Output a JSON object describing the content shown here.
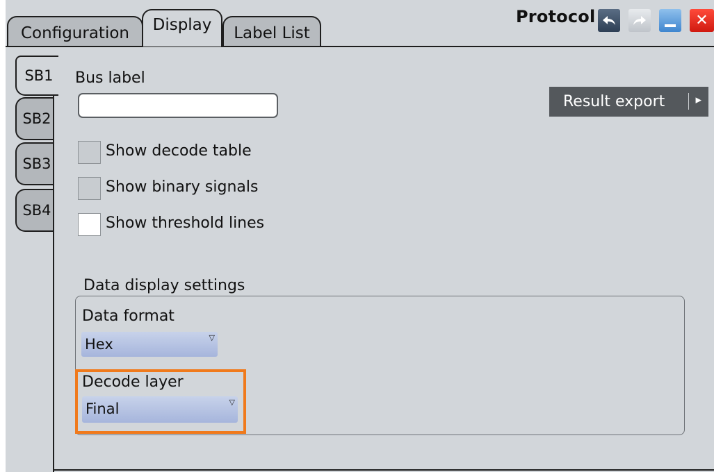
{
  "tabs": {
    "configuration": "Configuration",
    "display": "Display",
    "label_list": "Label List"
  },
  "header": {
    "title": "Protocol",
    "undo_icon": "undo-icon",
    "redo_icon": "redo-icon",
    "minimize_icon": "minimize-icon",
    "close_icon": "close-icon",
    "close_glyph": "✕"
  },
  "side_tabs": [
    "SB1",
    "SB2",
    "SB3",
    "SB4"
  ],
  "bus_label": {
    "title": "Bus label",
    "value": ""
  },
  "result_export": {
    "label": "Result export",
    "arrow": "▸"
  },
  "options": {
    "show_decode_table": {
      "label": "Show decode table",
      "checked": false
    },
    "show_binary_signals": {
      "label": "Show binary signals",
      "checked": false
    },
    "show_threshold_lines": {
      "label": "Show threshold lines",
      "checked": false
    }
  },
  "data_display": {
    "title": "Data display settings",
    "data_format": {
      "label": "Data format",
      "value": "Hex"
    },
    "decode_layer": {
      "label": "Decode layer",
      "value": "Final"
    }
  },
  "colors": {
    "highlight": "#f07a1c",
    "close": "#e0251a",
    "minimize": "#4a90d9",
    "select": "#b3c0e2"
  }
}
